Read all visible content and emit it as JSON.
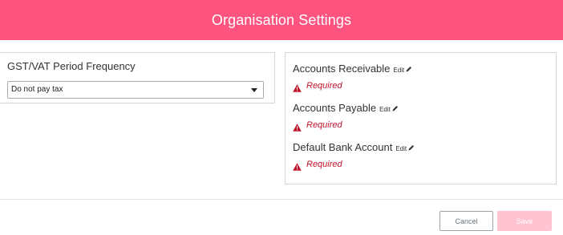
{
  "header": {
    "title": "Organisation Settings"
  },
  "gst": {
    "label": "GST/VAT Period Frequency",
    "selected": "Do not pay tax"
  },
  "accounts": [
    {
      "label": "Accounts Receivable",
      "edit": "Edit",
      "error": "Required"
    },
    {
      "label": "Accounts Payable",
      "edit": "Edit",
      "error": "Required"
    },
    {
      "label": "Default Bank Account",
      "edit": "Edit",
      "error": "Required"
    }
  ],
  "footer": {
    "cancel_label": "Cancel",
    "save_label": "Save"
  },
  "colors": {
    "brand": "#ff5480",
    "error": "#c0142b",
    "save_disabled": "#ffc3d1"
  },
  "icons": {
    "edit": "pencil-icon",
    "error": "warning-icon",
    "dropdown": "chevron-down-icon"
  }
}
